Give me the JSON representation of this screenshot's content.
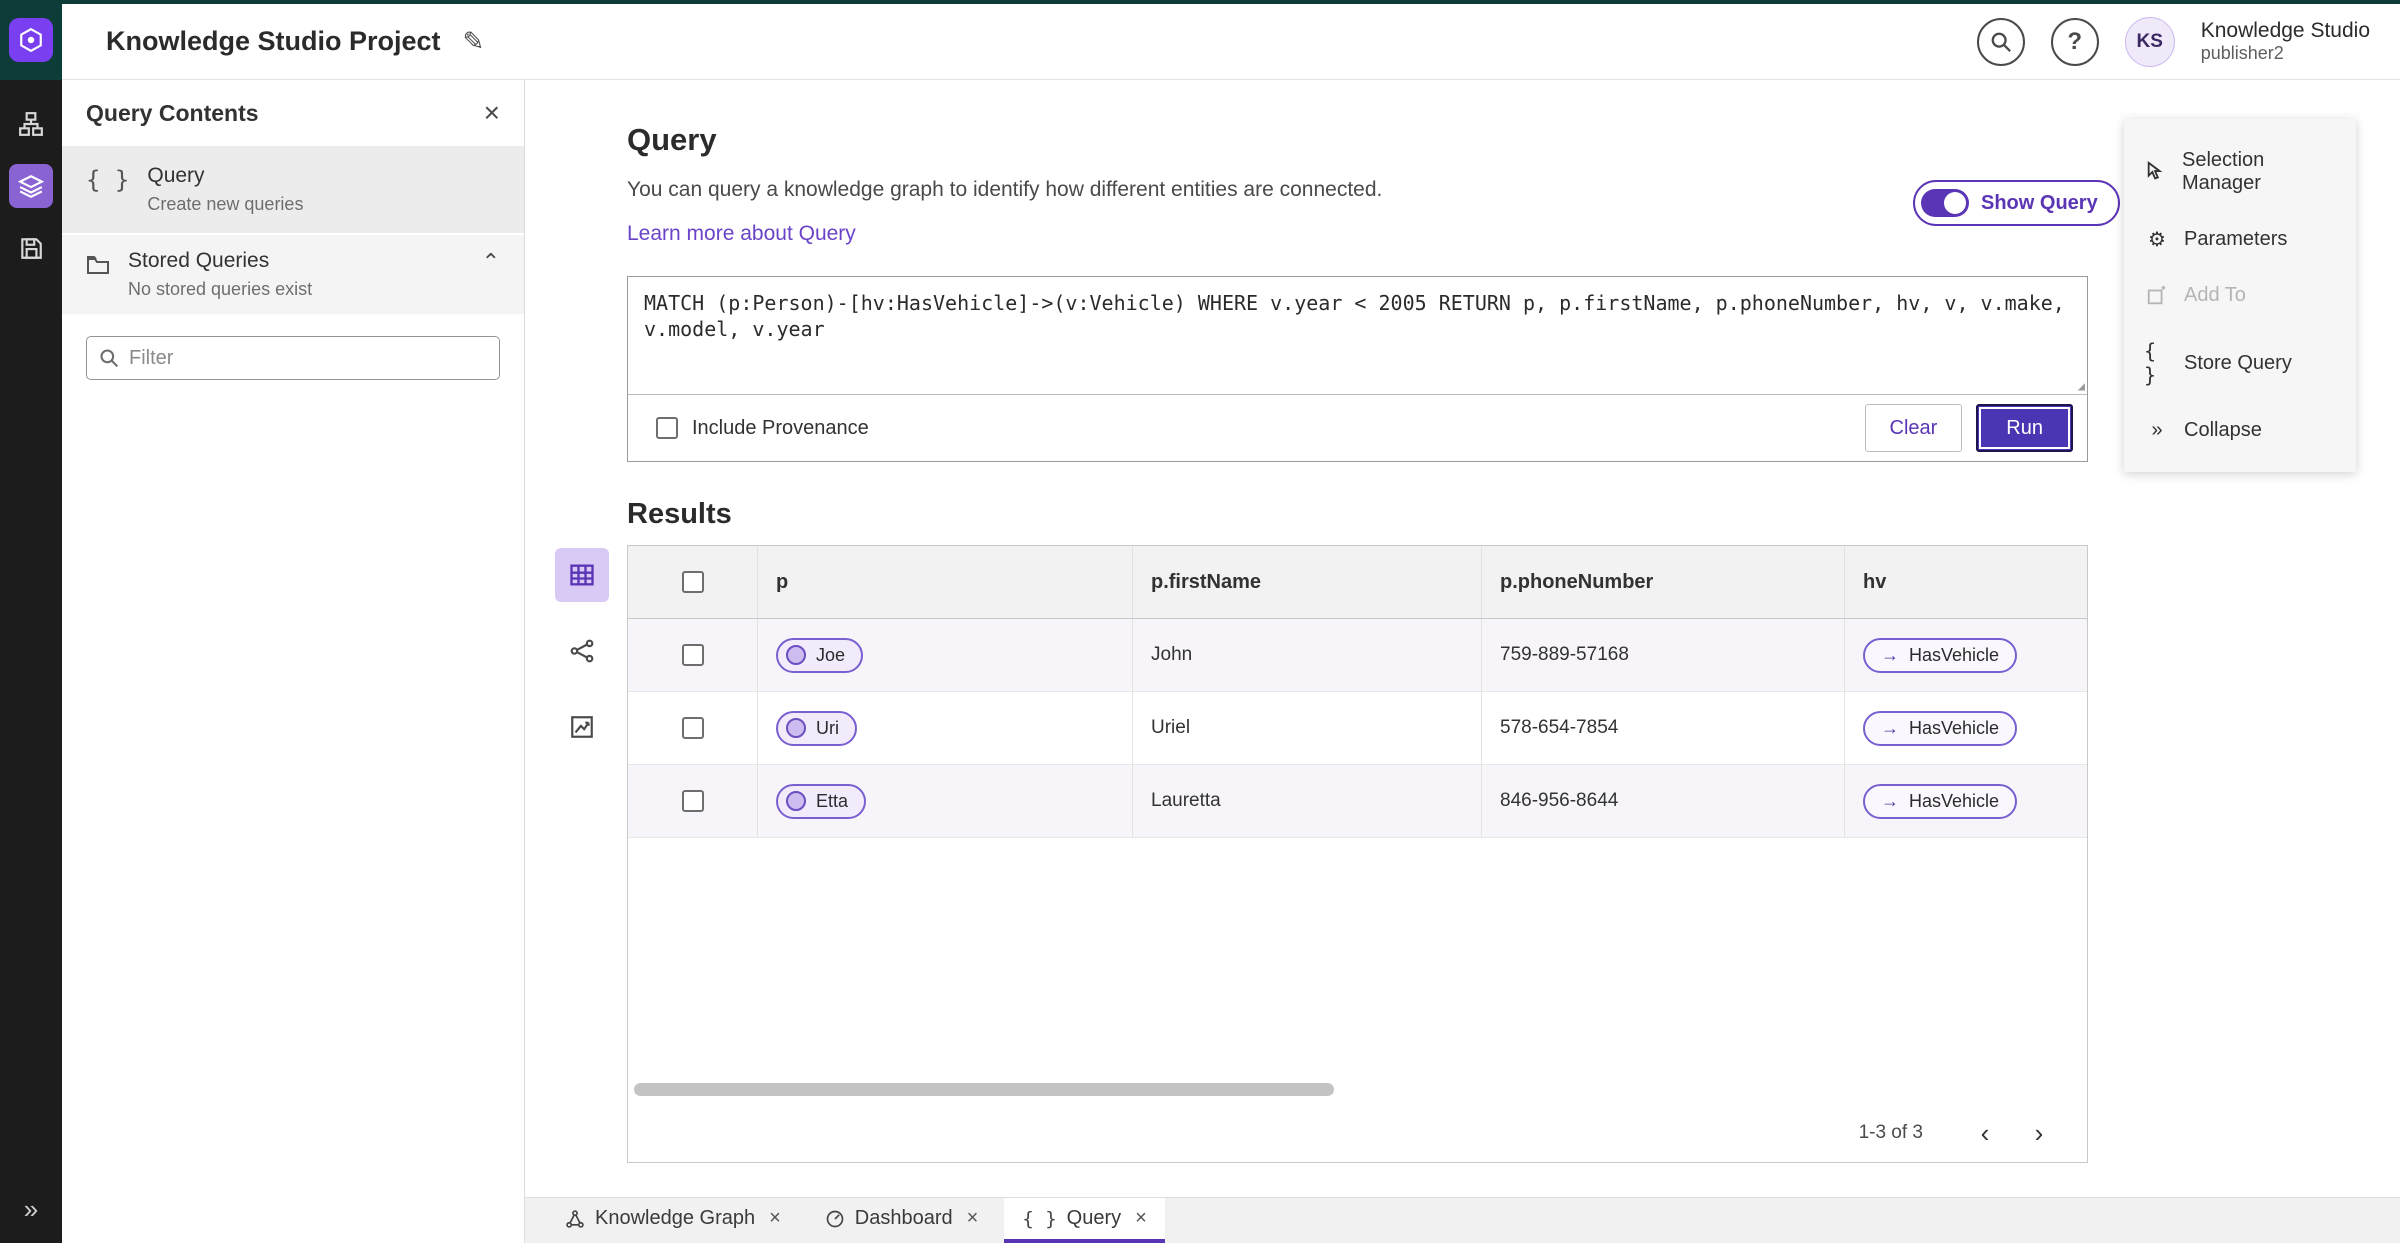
{
  "accent": "#5a35b5",
  "header": {
    "title": "Knowledge Studio Project",
    "user_initials": "KS",
    "user_name": "Knowledge Studio",
    "user_role": "publisher2"
  },
  "left_panel": {
    "title": "Query Contents",
    "query_item": {
      "label": "Query",
      "sublabel": "Create new queries"
    },
    "stored": {
      "label": "Stored Queries",
      "sublabel": "No stored queries exist"
    },
    "filter_placeholder": "Filter"
  },
  "query": {
    "title": "Query",
    "description": "You can query a knowledge graph to identify how different entities are connected.",
    "learn_more": "Learn more about Query",
    "show_query_label": "Show Query",
    "code": "MATCH (p:Person)-[hv:HasVehicle]->(v:Vehicle) WHERE v.year < 2005 RETURN p, p.firstName, p.phoneNumber, hv, v, v.make, v.model, v.year",
    "include_provenance_label": "Include Provenance",
    "clear_label": "Clear",
    "run_label": "Run"
  },
  "results": {
    "title": "Results",
    "columns": [
      "p",
      "p.firstName",
      "p.phoneNumber",
      "hv"
    ],
    "rows": [
      {
        "p": "Joe",
        "firstName": "John",
        "phone": "759-889-57168",
        "hv": "HasVehicle"
      },
      {
        "p": "Uri",
        "firstName": "Uriel",
        "phone": "578-654-7854",
        "hv": "HasVehicle"
      },
      {
        "p": "Etta",
        "firstName": "Lauretta",
        "phone": "846-956-8644",
        "hv": "HasVehicle"
      }
    ],
    "arrow": "→",
    "pagination": "1-3 of 3"
  },
  "right_panel": {
    "items": [
      {
        "label": "Selection Manager"
      },
      {
        "label": "Parameters"
      },
      {
        "label": "Add To"
      },
      {
        "label": "Store Query"
      },
      {
        "label": "Collapse"
      }
    ]
  },
  "tabs": [
    {
      "label": "Knowledge Graph"
    },
    {
      "label": "Dashboard"
    },
    {
      "label": "Query"
    }
  ],
  "icons": {
    "rail": [
      "hierarchy-icon",
      "layers-icon",
      "save-icon"
    ],
    "mini_toolbar": [
      "table-view-icon",
      "graph-view-icon",
      "chart-view-icon"
    ]
  }
}
